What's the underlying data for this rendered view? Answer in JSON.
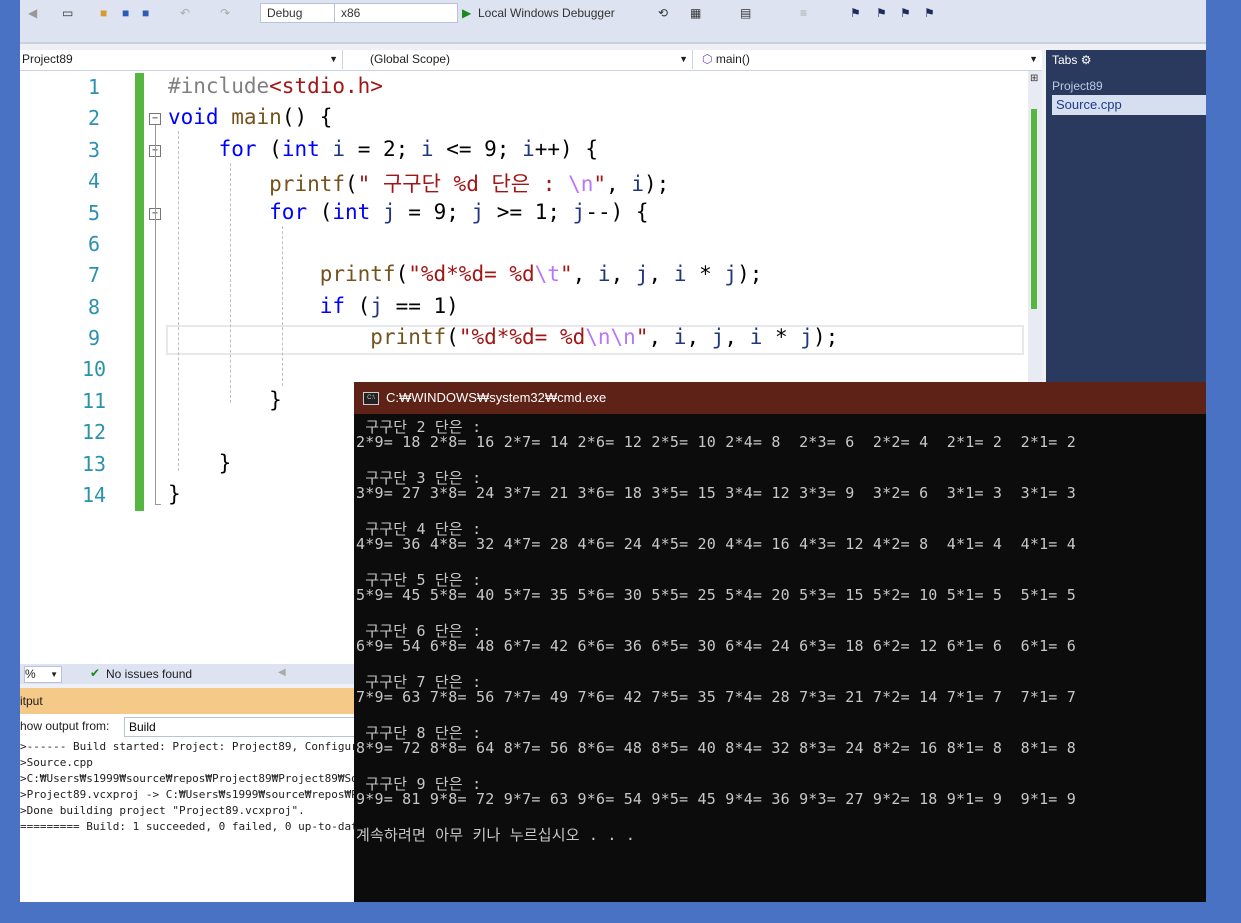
{
  "toolbar": {
    "config": "Debug",
    "platform": "x86",
    "run_label": "Local Windows Debugger"
  },
  "navbar": {
    "project": "Project89",
    "scope": "(Global Scope)",
    "member": "main()"
  },
  "editor": {
    "line_numbers": [
      "1",
      "2",
      "3",
      "4",
      "5",
      "6",
      "7",
      "8",
      "9",
      "10",
      "11",
      "12",
      "13",
      "14"
    ]
  },
  "status": {
    "zoom": "%",
    "issues": "No issues found"
  },
  "output": {
    "title": "itput",
    "show_from_label": "how output from:",
    "source": "Build",
    "lines": [
      ">------ Build started: Project: Project89, Configura",
      ">Source.cpp",
      ">C:₩Users₩s1999₩source₩repos₩Project89₩Project89₩Sou",
      ">Project89.vcxproj -> C:₩Users₩s1999₩source₩repos₩Pr",
      ">Done building project \"Project89.vcxproj\".",
      "========= Build: 1 succeeded, 0 failed, 0 up-to-date"
    ]
  },
  "tabs_panel": {
    "title": "Tabs",
    "project": "Project89",
    "file": "Source.cpp"
  },
  "cmd": {
    "title": "C:₩WINDOWS₩system32₩cmd.exe",
    "lines": [
      " 구구단 2 단은 :",
      "2*9= 18 2*8= 16 2*7= 14 2*6= 12 2*5= 10 2*4= 8  2*3= 6  2*2= 4  2*1= 2  2*1= 2",
      "",
      " 구구단 3 단은 :",
      "3*9= 27 3*8= 24 3*7= 21 3*6= 18 3*5= 15 3*4= 12 3*3= 9  3*2= 6  3*1= 3  3*1= 3",
      "",
      " 구구단 4 단은 :",
      "4*9= 36 4*8= 32 4*7= 28 4*6= 24 4*5= 20 4*4= 16 4*3= 12 4*2= 8  4*1= 4  4*1= 4",
      "",
      " 구구단 5 단은 :",
      "5*9= 45 5*8= 40 5*7= 35 5*6= 30 5*5= 25 5*4= 20 5*3= 15 5*2= 10 5*1= 5  5*1= 5",
      "",
      " 구구단 6 단은 :",
      "6*9= 54 6*8= 48 6*7= 42 6*6= 36 6*5= 30 6*4= 24 6*3= 18 6*2= 12 6*1= 6  6*1= 6",
      "",
      " 구구단 7 단은 :",
      "7*9= 63 7*8= 56 7*7= 49 7*6= 42 7*5= 35 7*4= 28 7*3= 21 7*2= 14 7*1= 7  7*1= 7",
      "",
      " 구구단 8 단은 :",
      "8*9= 72 8*8= 64 8*7= 56 8*6= 48 8*5= 40 8*4= 32 8*3= 24 8*2= 16 8*1= 8  8*1= 8",
      "",
      " 구구단 9 단은 :",
      "9*9= 81 9*8= 72 9*7= 63 9*6= 54 9*5= 45 9*4= 36 9*3= 27 9*2= 18 9*1= 9  9*1= 9",
      "",
      "계속하려면 아무 키나 누르십시오 . . ."
    ]
  }
}
